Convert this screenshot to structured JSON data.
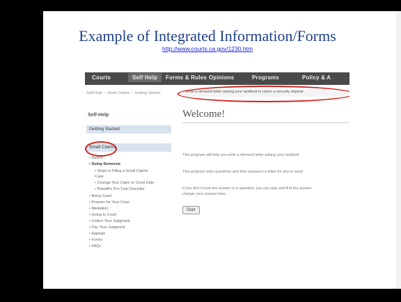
{
  "slide": {
    "title": "Example of Integrated Information/Forms",
    "link": "http://www.courts.ca.gov/1230.htm"
  },
  "screenshot": {
    "nav": [
      "Courts",
      "Self Help",
      "Forms & Rules",
      "Opinions",
      "Programs",
      "Policy & A"
    ],
    "breadcrumbs": [
      "Self-Help",
      "Small Claims",
      "Getting Started"
    ],
    "banner": "Write a demand letter asking your landlord to return a security deposit",
    "sidebar": {
      "title": "Self-Help",
      "section1": "Getting Started",
      "section2": "Small Claims",
      "items": [
        {
          "text": "• Basics",
          "bold": false
        },
        {
          "text": "• Suing Someone",
          "bold": true
        },
        {
          "text": "• Steps to Filing a Small Claims",
          "bold": false
        },
        {
          "text": "  Case",
          "bold": false
        },
        {
          "text": "• Change Your Claim or Court Date",
          "bold": false
        },
        {
          "text": "• Plaintiff's Pre-Trial Checklist",
          "bold": false
        },
        {
          "text": "• Being Sued",
          "bold": false
        },
        {
          "text": "• Prepare for Your Case",
          "bold": false
        },
        {
          "text": "• Mediation",
          "bold": false
        },
        {
          "text": "• Going to Court",
          "bold": false
        },
        {
          "text": "• Collect Your Judgment",
          "bold": false
        },
        {
          "text": "• Pay Your Judgment",
          "bold": false
        },
        {
          "text": "• Appeals",
          "bold": false
        },
        {
          "text": "• Forms",
          "bold": false
        },
        {
          "text": "• FAQs",
          "bold": false
        }
      ]
    },
    "main": {
      "heading": "Welcome!",
      "para1": "This program will help you write a demand letter asking your landlord",
      "para2": "This program asks questions and then prepares a letter for you to send",
      "para3a": "If you don't know the answer to a question, you can skip and find the answer",
      "para3b": "change your answer later.",
      "button": "Start"
    },
    "accent": "#d0201a"
  }
}
